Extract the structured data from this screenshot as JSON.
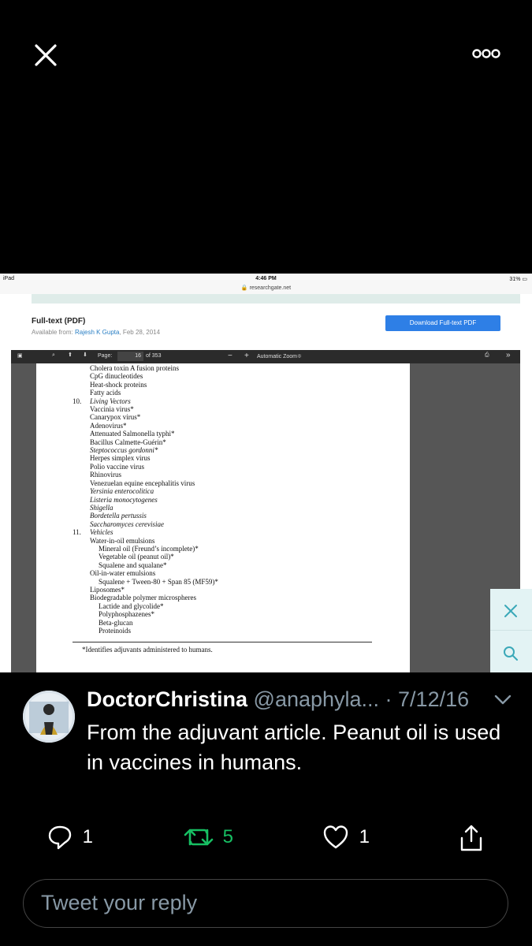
{
  "viewer": {
    "close_icon": "close-icon",
    "more_icon": "more-icon"
  },
  "ipad": {
    "carrier": "iPad",
    "time": "4:46 PM",
    "url": "researchgate.net",
    "battery": "31%"
  },
  "article": {
    "heading": "Full-text (PDF)",
    "available_prefix": "Available from: ",
    "author": "Rajesh K Gupta",
    "date": ", Feb 28, 2014",
    "download_label": "Download Full-text PDF"
  },
  "pdf_toolbar": {
    "page_label": "Page:",
    "page_value": "16",
    "page_total": "of 353",
    "minus": "−",
    "plus": "+",
    "zoom": "Automatic Zoom≑",
    "more": "»"
  },
  "pdf_lines": [
    "Cholera toxin A fusion proteins",
    "CpG dinucleotides",
    "Heat-shock proteins",
    "Fatty acids",
    "Living Vectors",
    "Vaccinia virus*",
    "Canarypox virus*",
    "Adenovirus*",
    "Attenuated Salmonella typhi*",
    "Bacillus Calmette-Guérin*",
    "Steptococcus gordonni*",
    "Herpes simplex virus",
    "Polio vaccine virus",
    "Rhinovirus",
    "Venezuelan equine encephalitis virus",
    "Yersinia enterocolitica",
    "Listeria monocytogenes",
    "Shigella",
    "Bordetella pertussis",
    "Saccharomyces cerevisiae",
    "Vehicles",
    "Water-in-oil emulsions",
    "Mineral oil (Freund’s incomplete)*",
    "Vegetable oil (peanut oil)*",
    "Squalene and squalane*",
    "Oil-in-water emulsions",
    "Squalene + Tween-80 + Span 85 (MF59)*",
    "Liposomes*",
    "Biodegradable polymer microspheres",
    "Lactide and glycolide*",
    "Polyphosphazenes*",
    "Beta-glucan",
    "Proteinoids"
  ],
  "pdf_numbers": {
    "n10": "10.",
    "n11": "11."
  },
  "pdf_footnote": "*Identifies adjuvants administered to humans.",
  "tweet": {
    "name": "DoctorChristina",
    "handle_date": " @anaphyla... · 7/12/16",
    "text": "From the adjuvant article. Peanut oil is used in vaccines in humans.",
    "reply_count": "1",
    "retweet_count": "5",
    "like_count": "1",
    "reply_placeholder": "Tweet your reply",
    "retweet_color": "#17bf63"
  }
}
